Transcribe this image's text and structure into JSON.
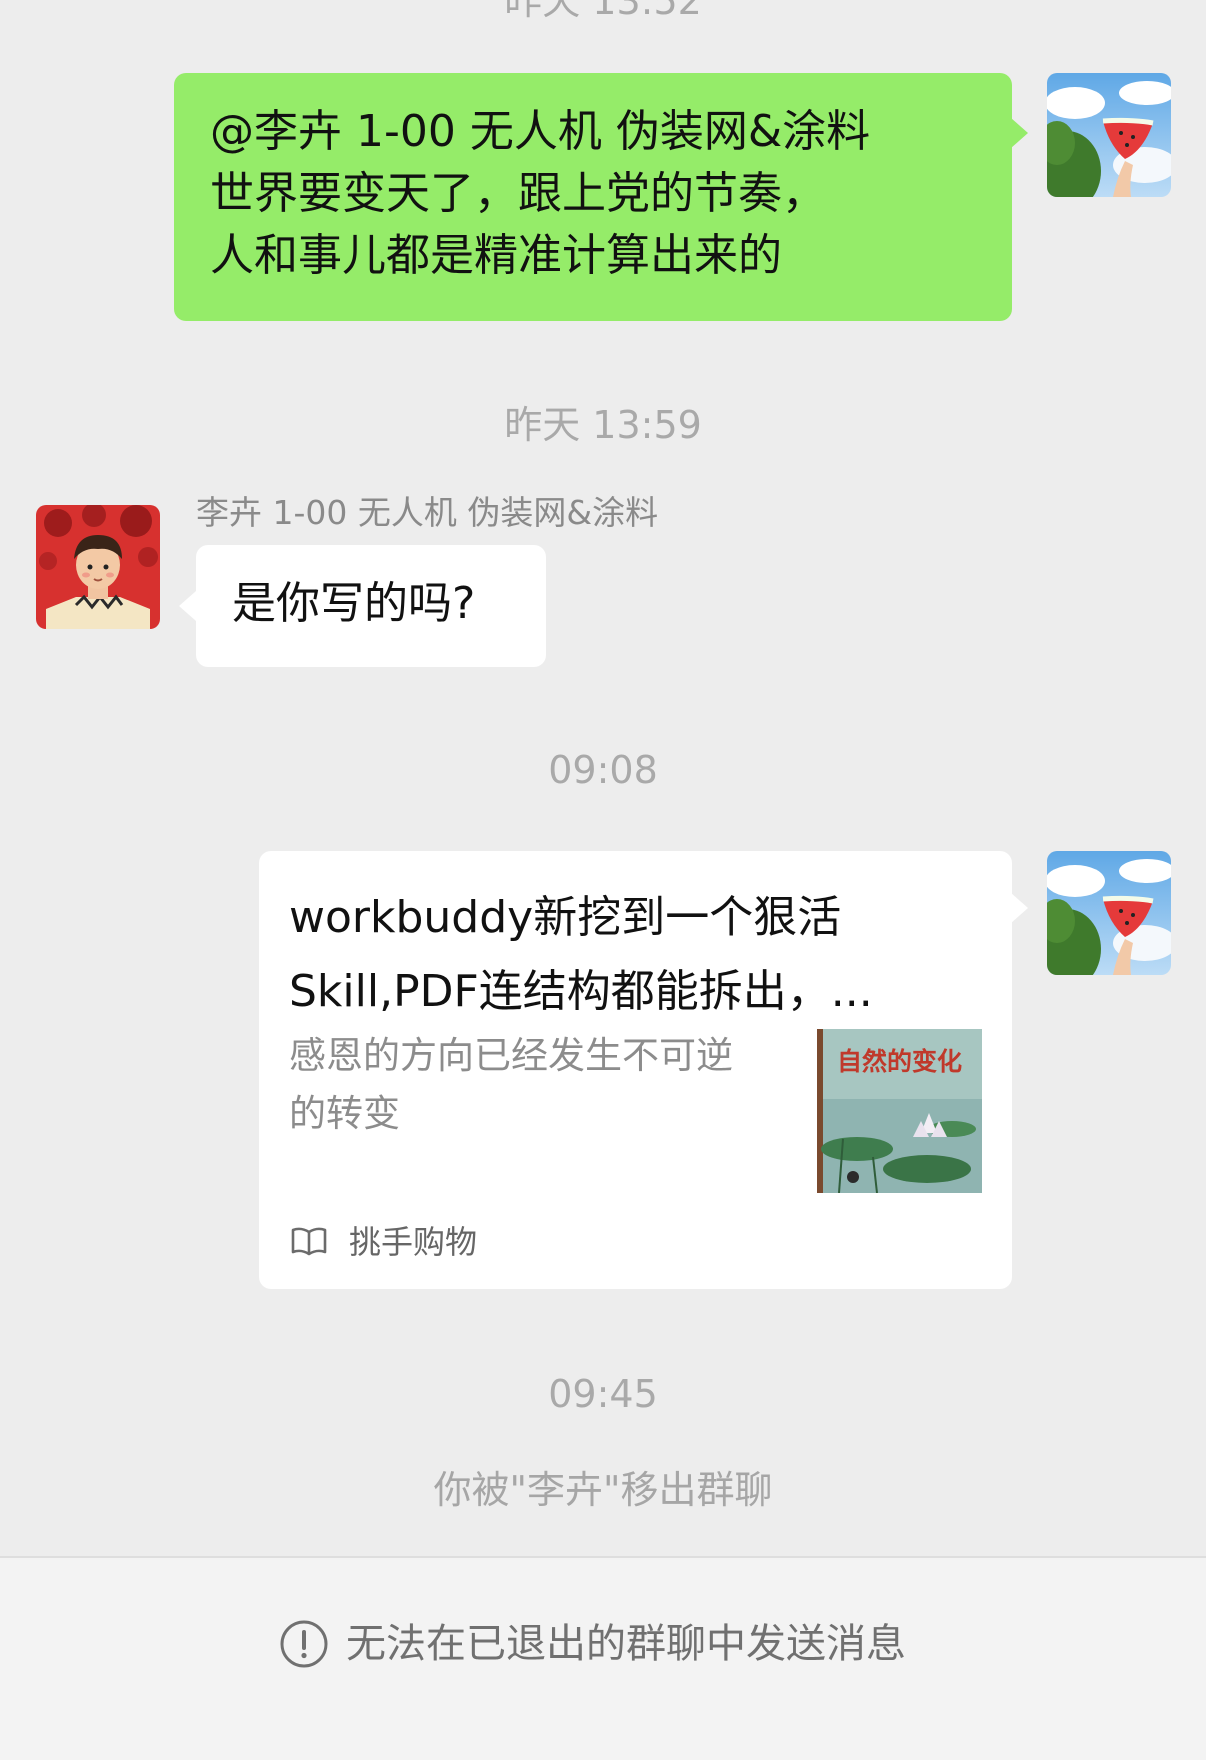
{
  "chat": {
    "timestamps": {
      "top_partial": "昨天 13:52",
      "t1": "昨天 13:59",
      "t2": "09:08",
      "t3": "09:45"
    },
    "messages": {
      "m1": {
        "lines": [
          "@李卉 1-00 无人机   伪装网&涂料",
          "世界要变天了，跟上党的节奏，",
          "人和事儿都是精准计算出来的"
        ]
      },
      "m2": {
        "sender": "李卉 1-00 无人机   伪装网&涂料",
        "text": "是你写的吗?"
      },
      "m3": {
        "title_lines": [
          "workbuddy新挖到一个狠活",
          "Skill,PDF连结构都能拆出，..."
        ],
        "desc_lines": [
          "感恩的方向已经发生不可逆",
          "的转变"
        ],
        "thumb_text": "自然的变化",
        "source": "挑手购物"
      }
    },
    "system_note": "你被\"李卉\"移出群聊"
  },
  "bottom_bar": {
    "message": "无法在已退出的群聊中发送消息"
  }
}
